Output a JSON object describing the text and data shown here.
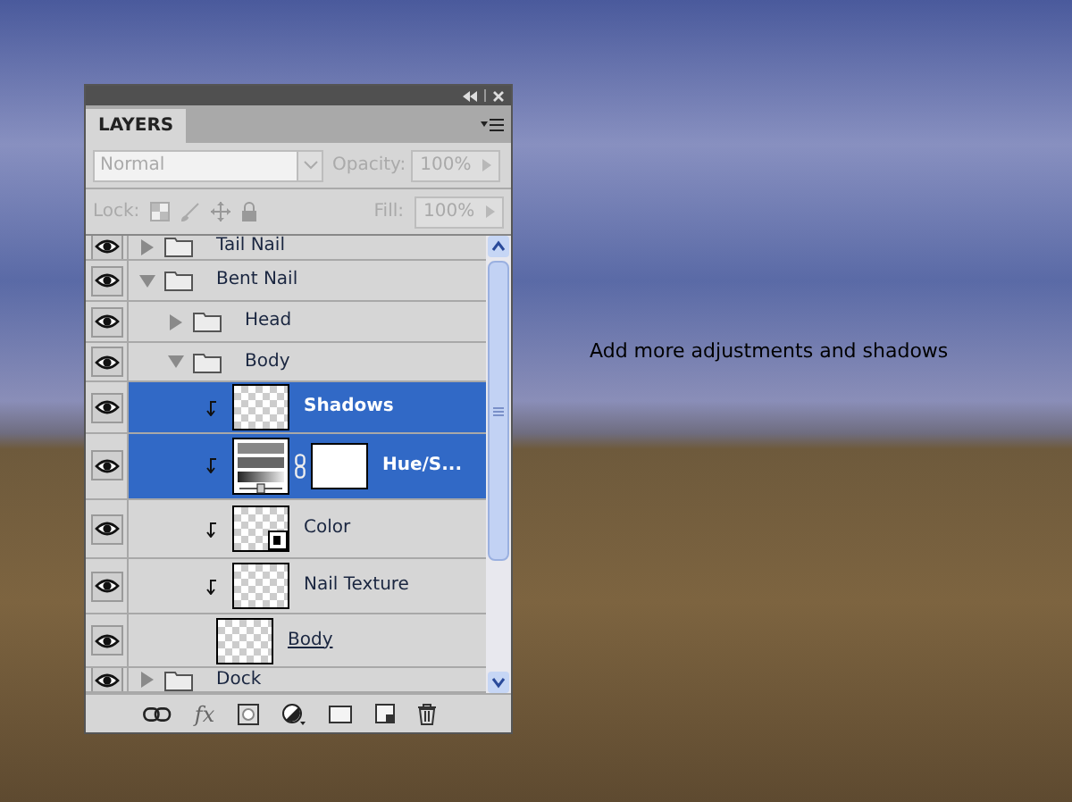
{
  "caption": "Add more adjustments and shadows",
  "panel": {
    "tab": "LAYERS",
    "blend_mode": {
      "value": "Normal",
      "disabled": true
    },
    "opacity": {
      "label": "Opacity:",
      "value": "100%",
      "disabled": true
    },
    "lock_label": "Lock:",
    "fill": {
      "label": "Fill:",
      "value": "100%",
      "disabled": true
    },
    "fx": "fx",
    "layers": [
      {
        "kind": "group",
        "name": "Tail Nail",
        "visible": true,
        "selected": false,
        "expanded": false
      },
      {
        "kind": "group",
        "name": "Bent Nail",
        "visible": true,
        "selected": false,
        "expanded": true,
        "children": [
          {
            "kind": "group",
            "name": "Head",
            "visible": true,
            "selected": false,
            "expanded": false
          },
          {
            "kind": "group",
            "name": "Body",
            "visible": true,
            "selected": false,
            "expanded": true,
            "children": [
              {
                "kind": "layer",
                "name": "Shadows",
                "visible": true,
                "selected": true,
                "clipped": true,
                "clip_base": false
              },
              {
                "kind": "adjustment",
                "name": "Hue/S...",
                "visible": true,
                "selected": true,
                "clipped": true,
                "clip_base": false
              },
              {
                "kind": "smart",
                "name": "Color",
                "visible": true,
                "selected": false,
                "clipped": true,
                "clip_base": false
              },
              {
                "kind": "layer",
                "name": "Nail Texture",
                "visible": true,
                "selected": false,
                "clipped": true,
                "clip_base": false
              },
              {
                "kind": "layer",
                "name": "Body",
                "visible": true,
                "selected": false,
                "clipped": false,
                "clip_base": true
              }
            ]
          }
        ]
      },
      {
        "kind": "group",
        "name": "Dock",
        "visible": true,
        "selected": false,
        "expanded": false
      }
    ]
  }
}
